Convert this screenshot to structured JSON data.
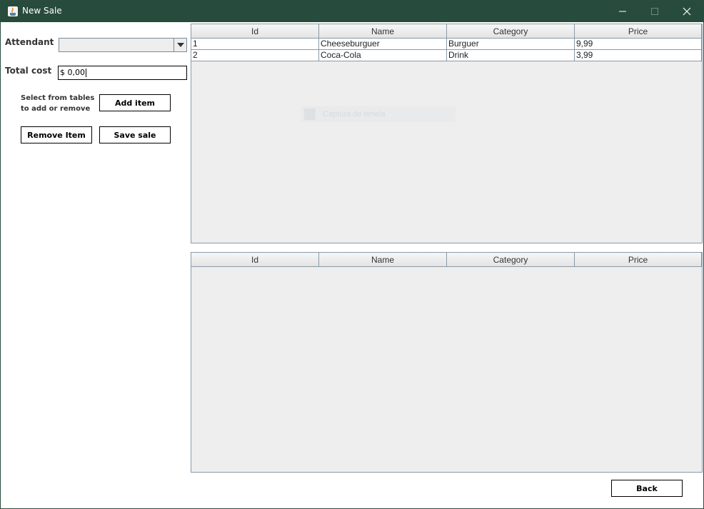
{
  "window": {
    "title": "New Sale",
    "controls": {
      "minimize": "minimize-icon",
      "maximize": "maximize-icon",
      "close": "close-icon"
    }
  },
  "form": {
    "attendant_label": "Attendant",
    "attendant_value": "",
    "total_cost_label": "Total cost",
    "total_cost_value": "$ 0,00",
    "hint_line1": "Select from tables",
    "hint_line2": "to add or remove",
    "add_item_label": "Add item",
    "remove_item_label": "Remove Item",
    "save_sale_label": "Save sale",
    "back_label": "Back"
  },
  "products_table": {
    "columns": [
      "Id",
      "Name",
      "Category",
      "Price"
    ],
    "rows": [
      [
        "1",
        "Cheeseburguer",
        "Burguer",
        "9,99"
      ],
      [
        "2",
        "Coca-Cola",
        "Drink",
        "3,99"
      ]
    ],
    "overlay_text": "Captura de tenela"
  },
  "sale_items_table": {
    "columns": [
      "Id",
      "Name",
      "Category",
      "Price"
    ],
    "rows": []
  },
  "colors": {
    "titlebar": "#274b3c",
    "panel_bg": "#eeeeee",
    "grid_line": "#8a9aa8"
  }
}
